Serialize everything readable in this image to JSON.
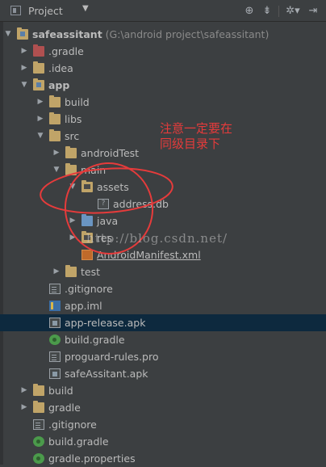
{
  "toolbar": {
    "title": "Project",
    "caret": "▼",
    "buttons": [
      {
        "icon": "sync-icon",
        "glyph": "⊕"
      },
      {
        "icon": "collapse-all-icon",
        "glyph": "⇟"
      },
      {
        "icon": "settings-gear-icon",
        "glyph": "✲▾"
      },
      {
        "icon": "hide-icon",
        "glyph": "⇥"
      }
    ]
  },
  "tree": [
    {
      "label": "safeassitant",
      "path": " (G:\\android project\\safeassitant)",
      "depth": 0,
      "expanded": true,
      "icon": "module-folder-icon",
      "bold": true
    },
    {
      "label": ".gradle",
      "depth": 1,
      "expanded": false,
      "icon": "excluded-folder-icon"
    },
    {
      "label": ".idea",
      "depth": 1,
      "expanded": false,
      "icon": "folder-icon"
    },
    {
      "label": "app",
      "depth": 1,
      "expanded": true,
      "icon": "module-folder-icon",
      "bold": true
    },
    {
      "label": "build",
      "depth": 2,
      "expanded": false,
      "icon": "folder-icon"
    },
    {
      "label": "libs",
      "depth": 2,
      "expanded": false,
      "icon": "folder-icon"
    },
    {
      "label": "src",
      "depth": 2,
      "expanded": true,
      "icon": "folder-icon"
    },
    {
      "label": "androidTest",
      "depth": 3,
      "expanded": false,
      "icon": "folder-icon"
    },
    {
      "label": "main",
      "depth": 3,
      "expanded": true,
      "icon": "folder-icon"
    },
    {
      "label": "assets",
      "depth": 4,
      "expanded": true,
      "icon": "resource-folder-icon"
    },
    {
      "label": "address.db",
      "depth": 5,
      "icon": "unknown-file-icon"
    },
    {
      "label": "java",
      "depth": 4,
      "expanded": false,
      "icon": "source-folder-icon"
    },
    {
      "label": "res",
      "depth": 4,
      "expanded": false,
      "icon": "resource-folder-icon"
    },
    {
      "label": "AndroidManifest.xml",
      "depth": 4,
      "icon": "xml-file-icon",
      "underline": true
    },
    {
      "label": "test",
      "depth": 3,
      "expanded": false,
      "icon": "folder-icon"
    },
    {
      "label": ".gitignore",
      "depth": 2,
      "icon": "text-file-icon"
    },
    {
      "label": "app.iml",
      "depth": 2,
      "icon": "iml-file-icon"
    },
    {
      "label": "app-release.apk",
      "depth": 2,
      "icon": "apk-file-icon",
      "selected": true
    },
    {
      "label": "build.gradle",
      "depth": 2,
      "icon": "gradle-file-icon"
    },
    {
      "label": "proguard-rules.pro",
      "depth": 2,
      "icon": "text-file-icon"
    },
    {
      "label": "safeAssitant.apk",
      "depth": 2,
      "icon": "apk-file-icon"
    },
    {
      "label": "build",
      "depth": 1,
      "expanded": false,
      "icon": "folder-icon"
    },
    {
      "label": "gradle",
      "depth": 1,
      "expanded": false,
      "icon": "folder-icon"
    },
    {
      "label": ".gitignore",
      "depth": 1,
      "icon": "text-file-icon"
    },
    {
      "label": "build.gradle",
      "depth": 1,
      "icon": "gradle-file-icon"
    },
    {
      "label": "gradle.properties",
      "depth": 1,
      "icon": "gradle-file-icon"
    }
  ],
  "annotation": {
    "text": "注意一定要在\n同级目录下",
    "color": "#e63b3b"
  },
  "watermark": "http://blog.csdn.net/",
  "colors": {
    "background": "#3c3f41",
    "selection": "#0d293e",
    "text": "#bbbbbb"
  }
}
